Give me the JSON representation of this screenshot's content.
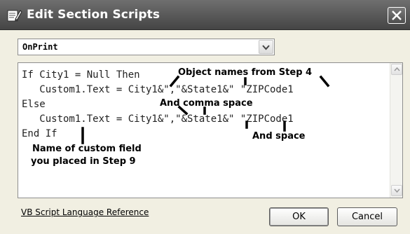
{
  "window": {
    "title": "Edit Section Scripts",
    "title_icon": "edit-script-icon",
    "close_icon": "close-icon"
  },
  "section_select": {
    "value": "OnPrint",
    "arrow_icon": "chevron-down-icon"
  },
  "script": {
    "lines": [
      "If City1 = Null Then",
      "   Custom1.Text = City1&\",\"&State1&\" \"ZIPCode1",
      "Else",
      "   Custom1.Text = City1&\",\"&State1&\" \"ZIPCode1",
      "End If"
    ]
  },
  "annotations": {
    "object_names": "Object names from Step 4",
    "comma_space": "And comma space",
    "and_space": "And space",
    "custom_field_line1": "Name of custom field",
    "custom_field_line2": "you placed in Step 9"
  },
  "footer": {
    "reference_link": "VB Script Language Reference",
    "ok_label": "OK",
    "cancel_label": "Cancel"
  },
  "colors": {
    "titlebar": "#5c5c5c",
    "dialog_background": "#f1efe2",
    "editor_background": "#ffffff"
  }
}
